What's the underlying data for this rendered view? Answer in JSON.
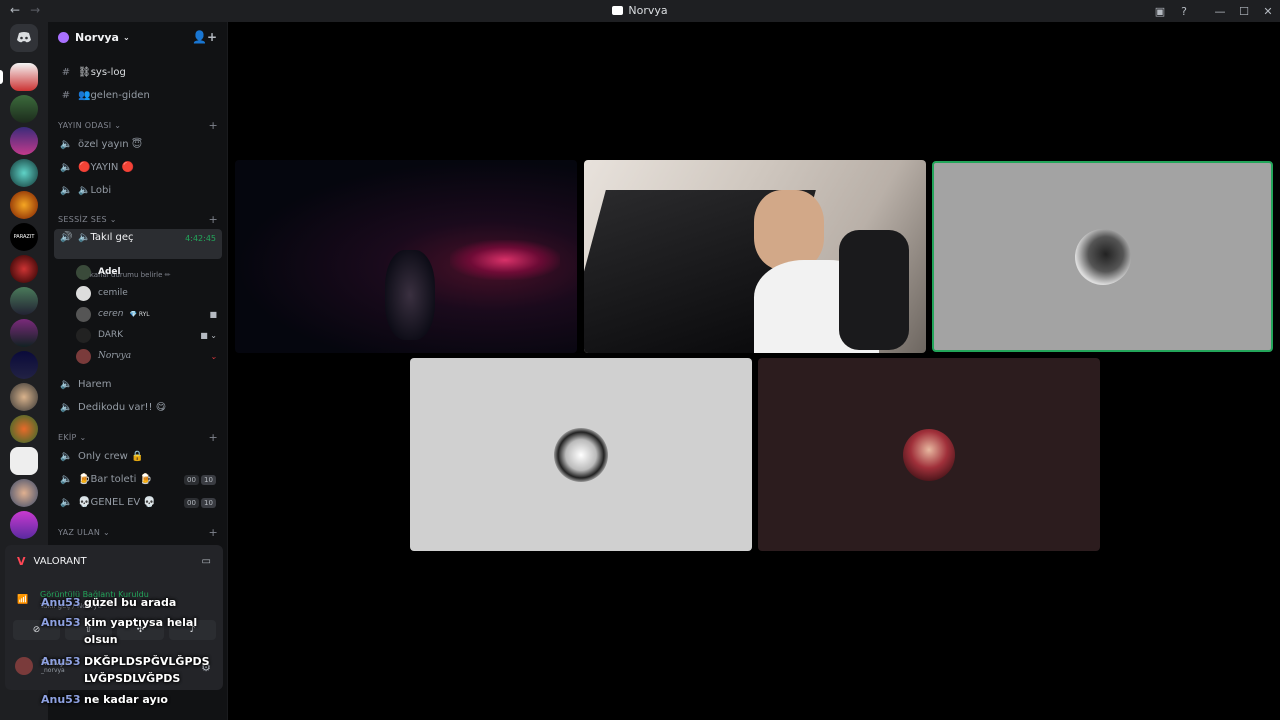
{
  "window": {
    "title": "Norvya"
  },
  "server": {
    "name": "Norvya"
  },
  "text_channels": [
    {
      "name": "⛓sys-log"
    },
    {
      "name": "👥gelen-giden"
    }
  ],
  "categories": {
    "yayin": "YAYIN ODASI",
    "sessiz": "SESSİZ SES",
    "ekip": "EKİP",
    "yaz": "YAZ ULAN"
  },
  "yayin_channels": [
    "özel yayın 😇",
    "🔴YAYIN 🔴",
    "🔈Lobi"
  ],
  "active_channel": {
    "name": "🔈Takıl geç",
    "timer": "4:42:45",
    "status_hint": "Bir kanal durumu belirle ✏"
  },
  "voice_users": [
    "Adel",
    "cemile",
    "ceren",
    "DARK",
    "Norvya"
  ],
  "voice_user_tag": "RYL",
  "sessiz_channels": [
    "Harem",
    "Dedikodu var!! 😋"
  ],
  "ekip_channels": [
    {
      "name": "Only crew 🔒"
    },
    {
      "name": "🍺Bar toleti 🍺",
      "count": "00",
      "limit": "10"
    },
    {
      "name": "💀GENEL EV 💀",
      "count": "00",
      "limit": "10"
    }
  ],
  "voice_panel": {
    "game": "VALORANT",
    "connected": "Görüntülü Bağlantı Kuruldu",
    "location": "Takıl geç / Norvya",
    "user": "Norvya",
    "user_tag": "_norvya"
  },
  "overlay_messages": [
    {
      "author": "Anu53",
      "text": "güzel bu arada"
    },
    {
      "author": "Anu53",
      "text": "kim yaptıysa helal olsun"
    },
    {
      "author": "Anu53",
      "text": "DKĞPLDSPĞVLĞPDS LVĞPSDLVĞPDS"
    },
    {
      "author": "Anu53",
      "text": "ne kadar ayıo"
    }
  ],
  "colors": {
    "speaking": "#23a55a",
    "accent": "#5865f2",
    "valorant": "#ff4655"
  }
}
